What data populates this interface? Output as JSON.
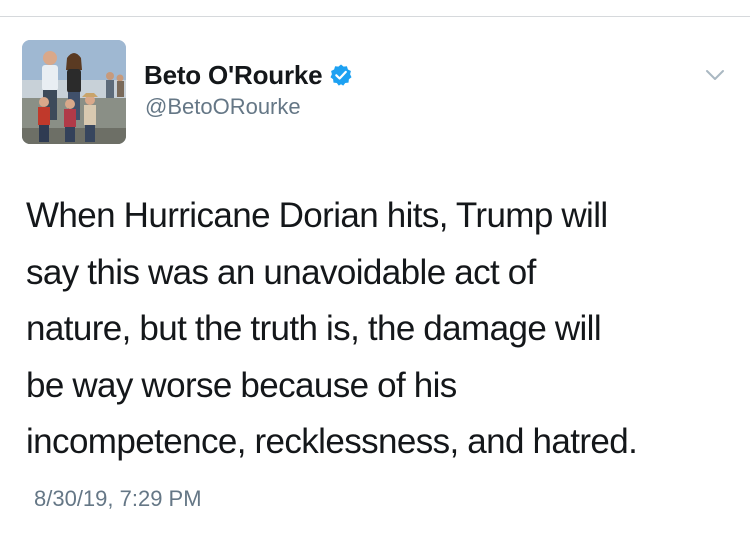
{
  "tweet": {
    "author": {
      "display_name": "Beto O'Rourke",
      "handle": "@BetoORourke",
      "verified": true,
      "avatar_description": "family photo outdoors"
    },
    "text_lines": [
      "When Hurricane Dorian hits, Trump will",
      "say this was an unavoidable act of",
      "nature, but the truth is, the damage will",
      "be way worse because of his",
      "incompetence, recklessness, and hatred."
    ],
    "timestamp": "8/30/19, 7:29 PM"
  },
  "icons": {
    "verified": "verified-badge-icon",
    "menu": "chevron-down-icon"
  },
  "colors": {
    "text": "#14171a",
    "secondary": "#657786",
    "verified_blue": "#1da1f2",
    "divider": "#d6d9dc"
  }
}
